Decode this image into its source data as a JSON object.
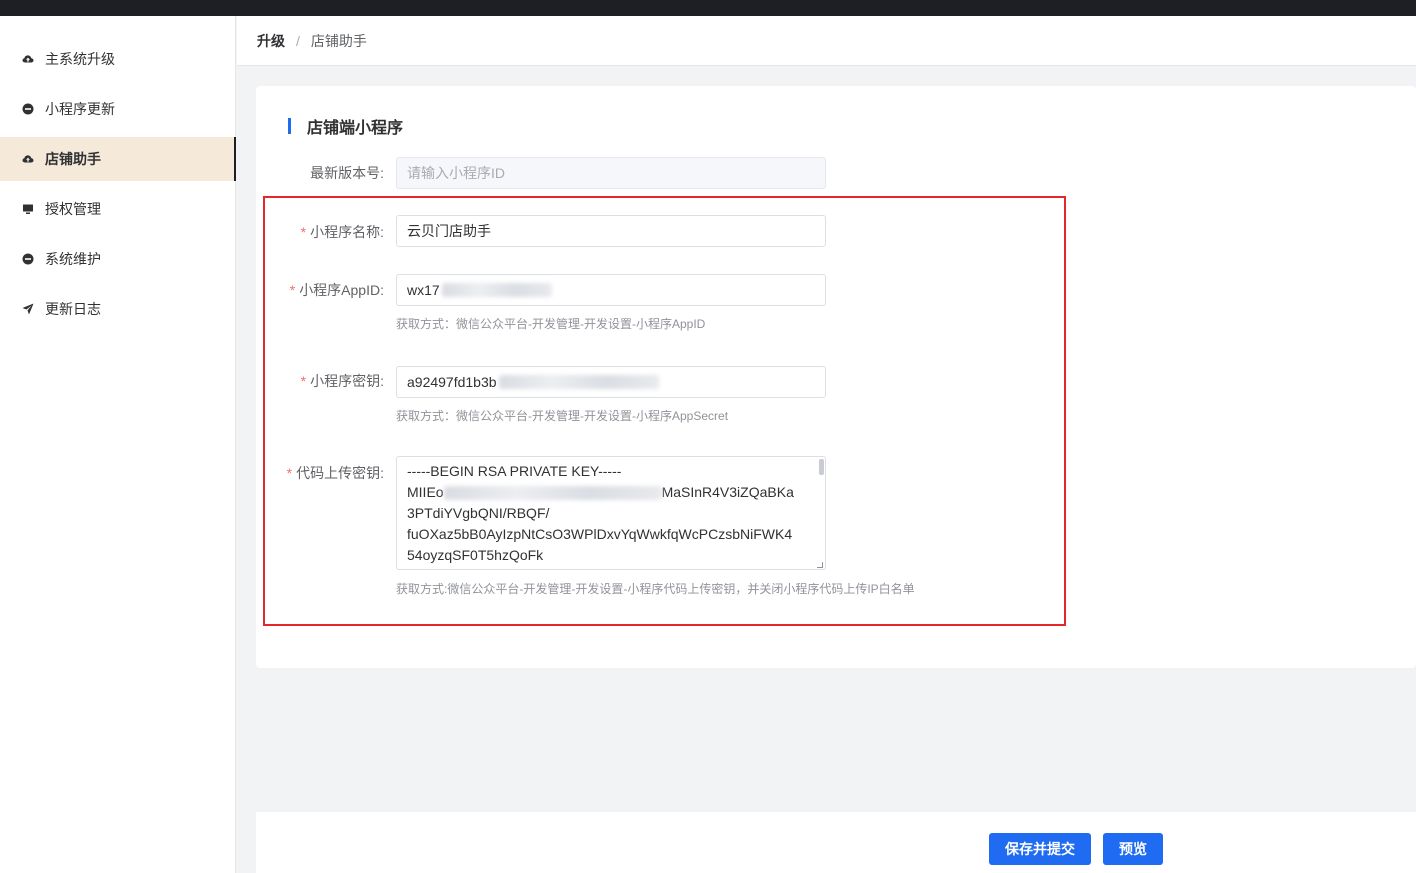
{
  "sidebar": {
    "items": [
      {
        "label": "主系统升级",
        "icon": "cloud-upload-icon"
      },
      {
        "label": "小程序更新",
        "icon": "minus-circle-icon"
      },
      {
        "label": "店铺助手",
        "icon": "cloud-upload-icon",
        "active": true
      },
      {
        "label": "授权管理",
        "icon": "monitor-icon"
      },
      {
        "label": "系统维护",
        "icon": "minus-circle-icon"
      },
      {
        "label": "更新日志",
        "icon": "send-icon"
      }
    ]
  },
  "breadcrumb": {
    "root": "升级",
    "separator": "/",
    "current": "店铺助手"
  },
  "section": {
    "title": "店铺端小程序"
  },
  "form": {
    "version": {
      "label": "最新版本号:",
      "placeholder": "请输入小程序ID"
    },
    "name": {
      "label": "小程序名称:",
      "value": "云贝门店助手"
    },
    "appid": {
      "label": "小程序AppID:",
      "value": "wx17",
      "help": "获取方式：微信公众平台-开发管理-开发设置-小程序AppID"
    },
    "secret": {
      "label": "小程序密钥:",
      "value": "a92497fd1b3b",
      "help": "获取方式：微信公众平台-开发管理-开发设置-小程序AppSecret"
    },
    "upload_key": {
      "label": "代码上传密钥:",
      "line1": "-----BEGIN RSA PRIVATE KEY-----",
      "line2_start": "MIIEo",
      "line2_end": "MaSInR4V3iZQaBKa",
      "line3": "3PTdiYVgbQNI/RBQF/",
      "line4": "fuOXaz5bB0AyIzpNtCsO3WPlDxvYqWwkfqWcPCzsbNiFWK4",
      "line5": "54oyzqSF0T5hzQoFk",
      "help": "获取方式:微信公众平台-开发管理-开发设置-小程序代码上传密钥，并关闭小程序代码上传IP白名单"
    }
  },
  "actions": {
    "save_label": "保存并提交",
    "preview_label": "预览"
  },
  "colors": {
    "primary": "#1f6bf2",
    "highlight": "#e5262a",
    "required": "#f56c6c",
    "active_bg": "#f5e9d9"
  }
}
